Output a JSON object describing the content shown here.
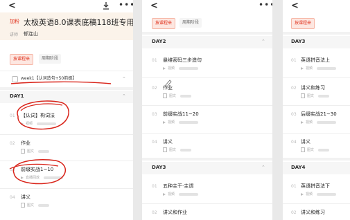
{
  "panel1": {
    "header": {
      "tag": "加粉",
      "title": "太极英语8.0课表底稿118班专用",
      "teacher_label": "讲师",
      "teacher": "郁连山"
    },
    "tabs": [
      "按课程来",
      "周期阶段"
    ],
    "week_label": "week1【认词造句+50前缀】",
    "day": "DAY1",
    "items": [
      {
        "index": "01",
        "title": "【认词】构词法",
        "meta": "视频"
      },
      {
        "index": "02",
        "title": "作业",
        "meta": "图文"
      },
      {
        "index": "03",
        "title": "前缀实战1~10",
        "meta": "直播回放"
      },
      {
        "index": "04",
        "title": "讲义",
        "meta": "图文"
      }
    ]
  },
  "panel2": {
    "tabs": [
      "按课程来",
      "周期阶段"
    ],
    "day2": "DAY2",
    "day2_items": [
      {
        "index": "01",
        "title": "悬维密码三步造句",
        "meta": "视频"
      },
      {
        "index": "02",
        "title": "作业",
        "meta": "图文"
      },
      {
        "index": "03",
        "title": "前缀实战11~20",
        "meta": "视频"
      },
      {
        "index": "04",
        "title": "讲义",
        "meta": "图文"
      }
    ],
    "day3": "DAY3",
    "day3_items": [
      {
        "index": "01",
        "title": "五种主干·主谓",
        "meta": "视频"
      },
      {
        "index": "02",
        "title": "讲义和作业",
        "meta": "图文"
      }
    ]
  },
  "panel3": {
    "tabs": [
      "按课程来"
    ],
    "day3": "DAY3",
    "day3_items": [
      {
        "index": "01",
        "title": "英语拼音法上",
        "meta": "视频"
      },
      {
        "index": "02",
        "title": "讲义和练习",
        "meta": "图文"
      },
      {
        "index": "03",
        "title": "后缀实战21~30",
        "meta": "视频"
      },
      {
        "index": "04",
        "title": "讲义",
        "meta": "图文"
      }
    ],
    "day4": "DAY4",
    "day4_items": [
      {
        "index": "01",
        "title": "英语拼音法下",
        "meta": "视频"
      },
      {
        "index": "02",
        "title": "讲义和练习",
        "meta": "图文"
      }
    ]
  },
  "icons": {
    "back": "<",
    "more": "•••"
  },
  "colors": {
    "accent": "#e0341f",
    "annotation": "#d9241a",
    "header_bg": "#fbf3ea"
  }
}
